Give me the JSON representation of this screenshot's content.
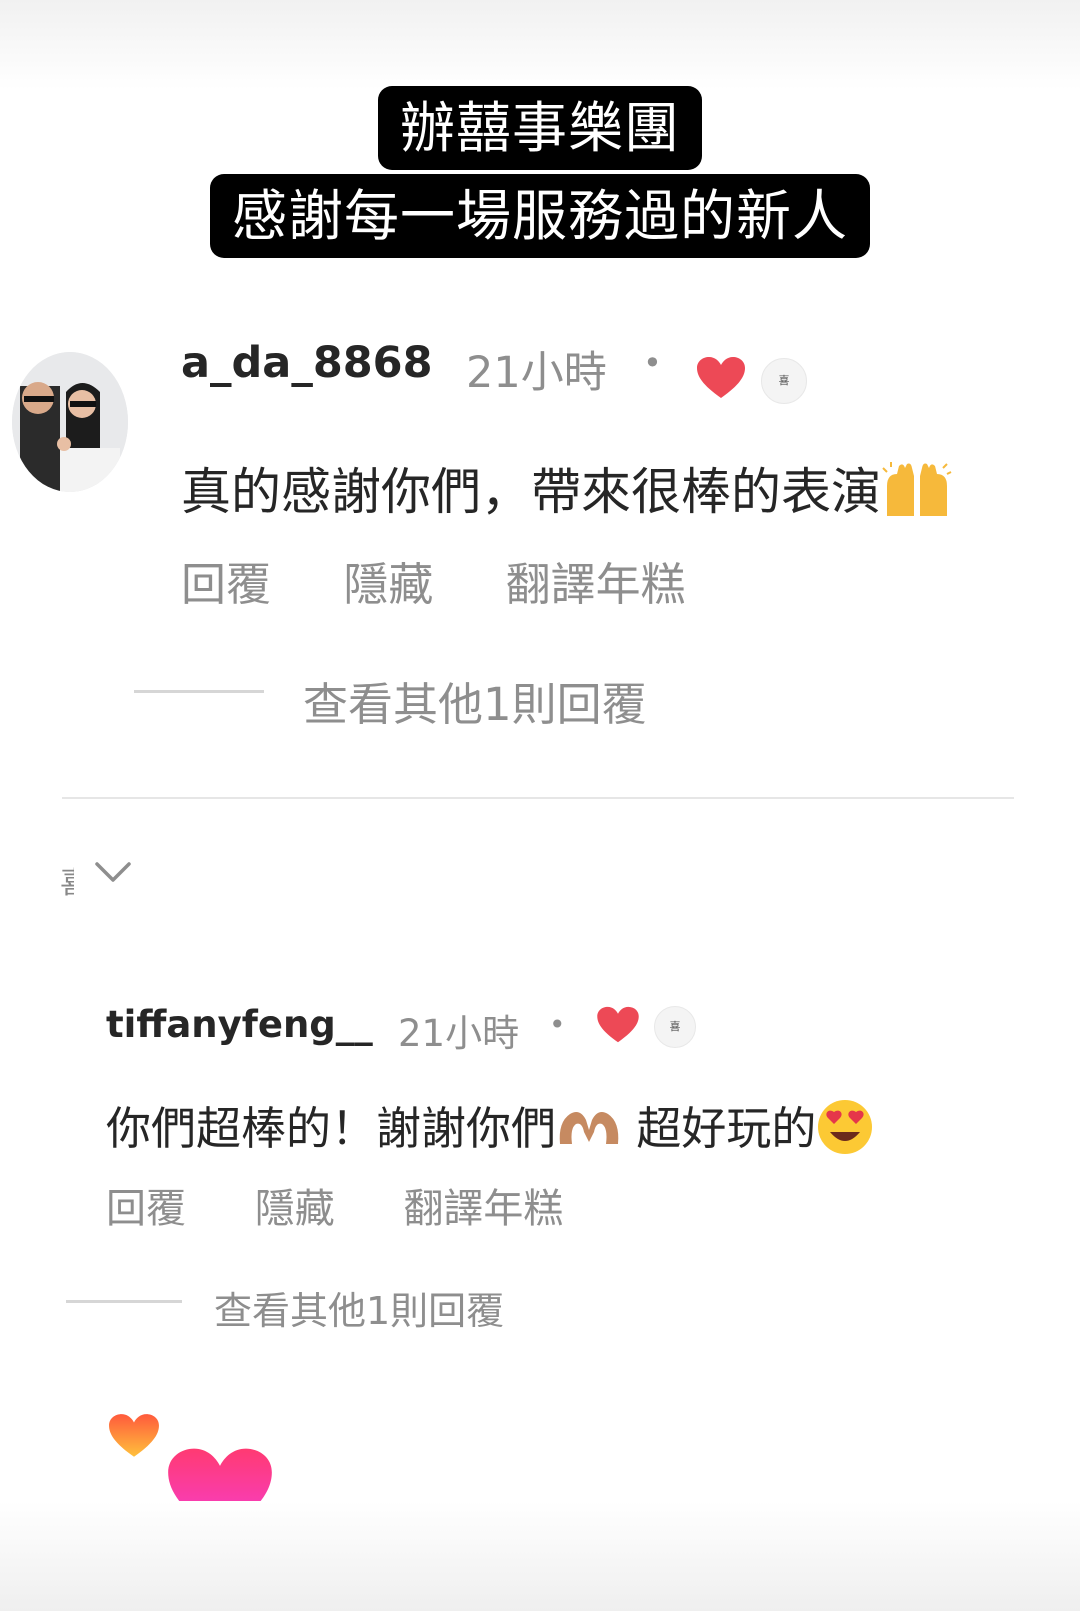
{
  "caption": {
    "line1": "辦囍事樂團",
    "line2": "感謝每一場服務過的新人"
  },
  "comments": [
    {
      "username": "a_da_8868",
      "time": "21小時",
      "dot": "•",
      "liked": true,
      "text": "真的感謝你們，帶來很棒的表演",
      "emoji": "raising-hands",
      "actions": {
        "reply": "回覆",
        "hide": "隱藏",
        "translate": "翻譯年糕"
      },
      "view_replies": "查看其他1則回覆"
    },
    {
      "username": "tiffanyfeng__",
      "time": "21小時",
      "dot": "•",
      "liked": true,
      "text_part1": "你們超棒的！謝謝你們",
      "emoji1": "heart-hands",
      "text_part2": " 超好玩的",
      "emoji2": "heart-eyes",
      "actions": {
        "reply": "回覆",
        "hide": "隱藏",
        "translate": "翻譯年糕"
      },
      "view_replies": "查看其他1則回覆"
    }
  ],
  "side_glyph": "喜",
  "colors": {
    "like_red": "#ed4956",
    "muted_text": "#8e8e8e",
    "caption_bg": "#000000",
    "floating_heart_orange": "#ff9a3c",
    "floating_heart_pink": "#ff2d8e"
  }
}
